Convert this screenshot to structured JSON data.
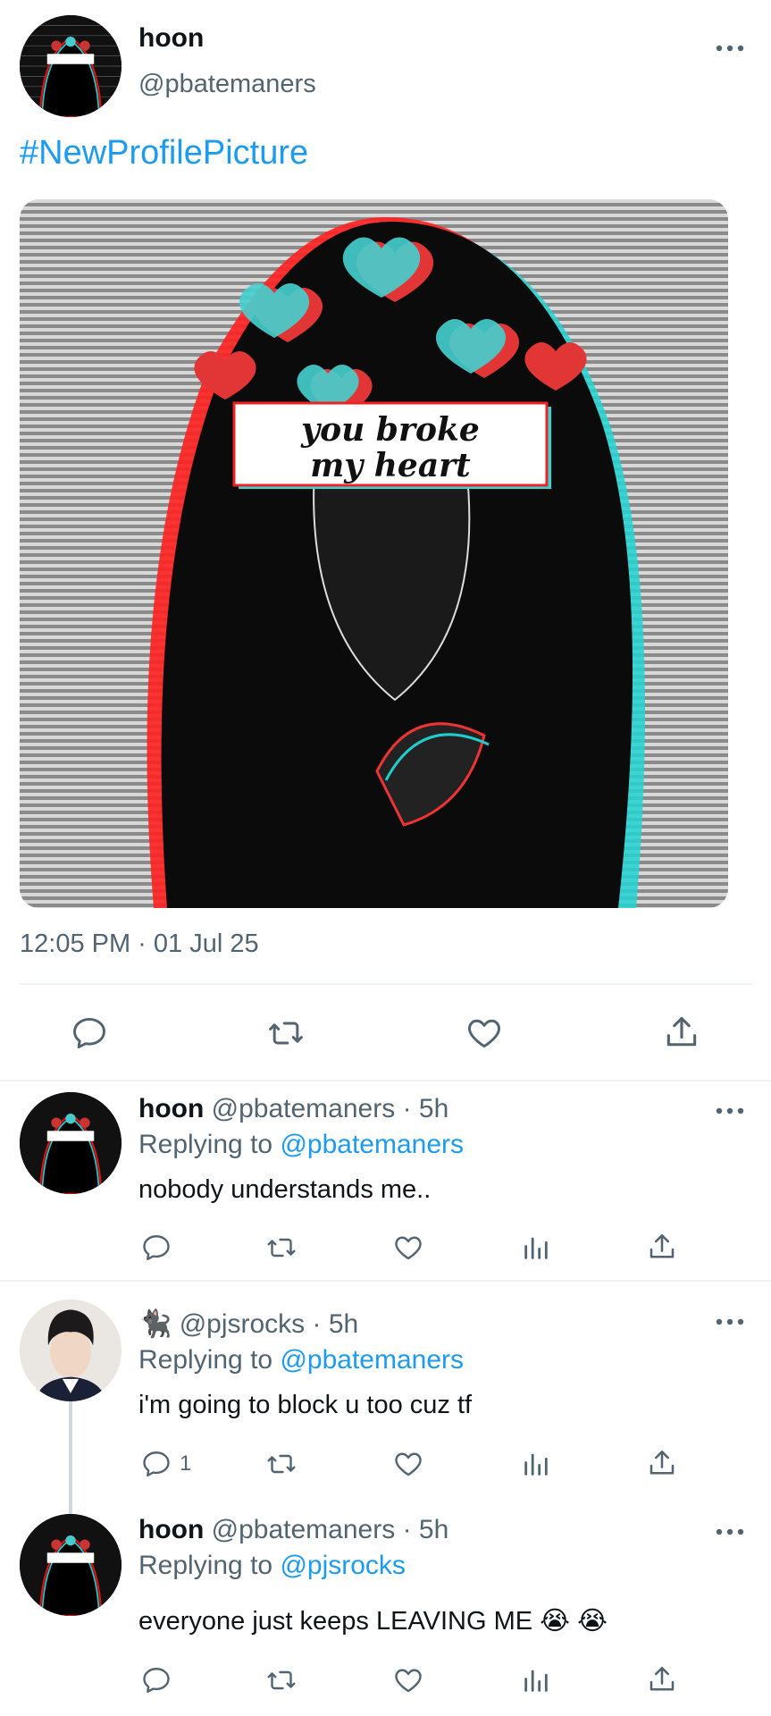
{
  "tweet": {
    "author_name": "hoon",
    "author_handle": "@pbatemaners",
    "text": "#NewProfilePicture",
    "image_text": [
      "you broke",
      "my heart"
    ],
    "timestamp": "12:05 PM · 01 Jul 25"
  },
  "replies": [
    {
      "name": "hoon",
      "handle": "@pbatemaners",
      "time": "· 5h",
      "replying_label": "Replying to",
      "replying_to": "@pbatemaners",
      "text": "nobody understands me..",
      "reply_count": ""
    },
    {
      "name": "🐈‍⬛",
      "handle": "@pjsrocks",
      "time": "· 5h",
      "replying_label": "Replying to",
      "replying_to": "@pbatemaners",
      "text": "i'm going to block u too cuz tf",
      "reply_count": "1"
    },
    {
      "name": "hoon",
      "handle": "@pbatemaners",
      "time": "· 5h",
      "replying_label": "Replying to",
      "replying_to": "@pjsrocks",
      "text": "everyone just keeps LEAVING ME 😭 😭",
      "reply_count": ""
    }
  ],
  "icons": [
    "more-icon",
    "reply-icon",
    "retweet-icon",
    "like-icon",
    "analytics-icon",
    "share-icon"
  ],
  "colors": {
    "link": "#1d9bf0",
    "muted": "#536471",
    "text": "#0f1419"
  }
}
